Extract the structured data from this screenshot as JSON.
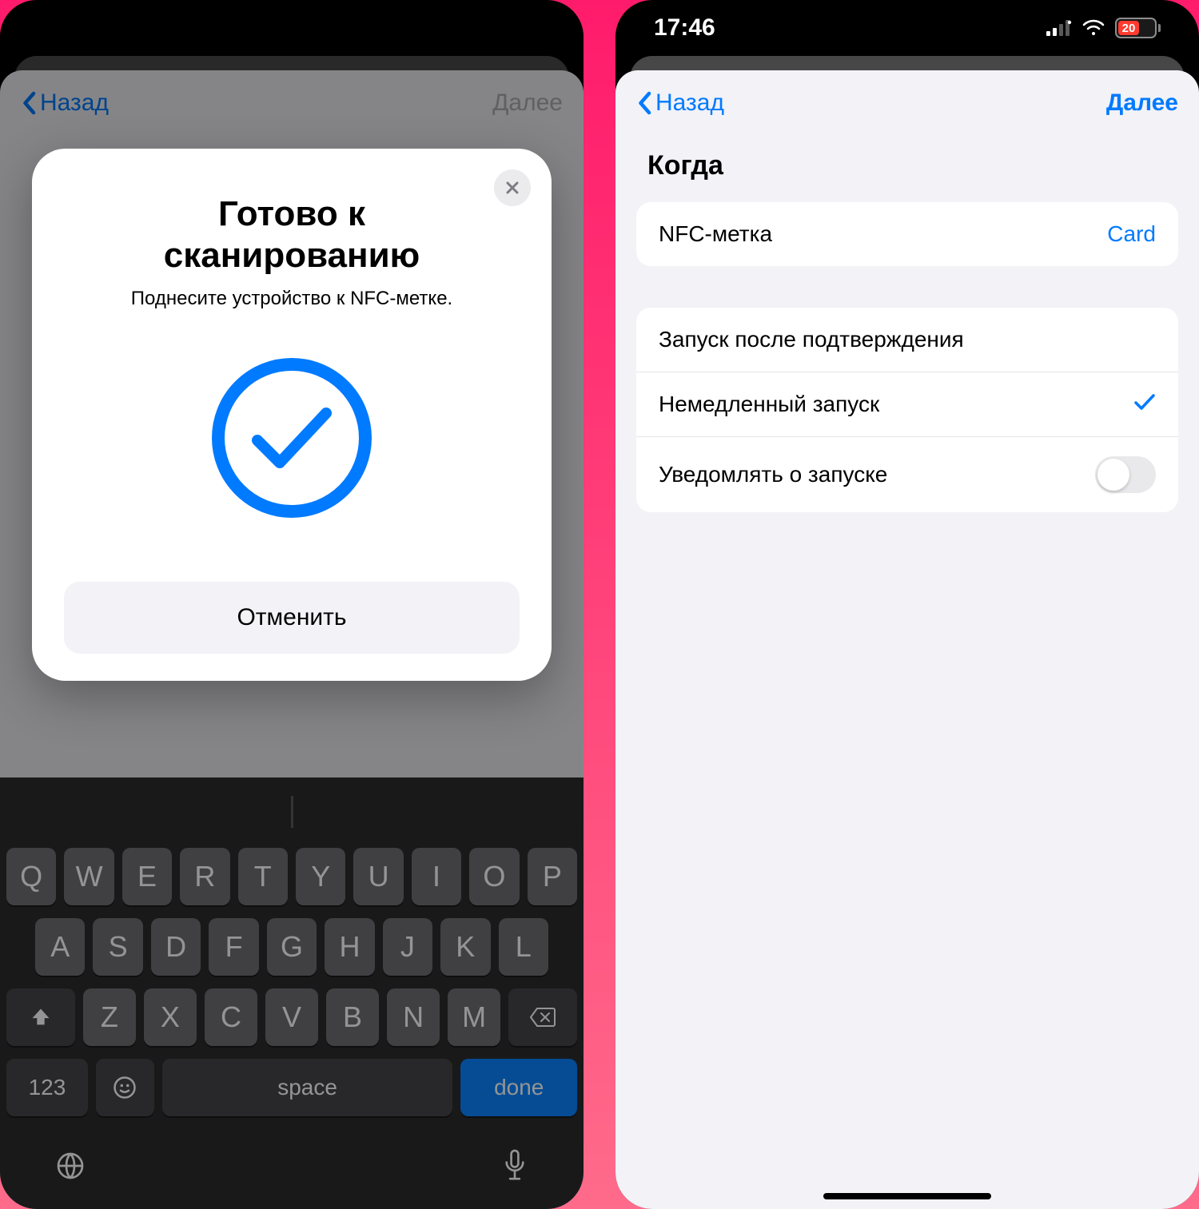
{
  "status": {
    "time": "17:46",
    "battery_pct": "20"
  },
  "nav": {
    "back": "Назад",
    "next": "Далее"
  },
  "modal": {
    "title_line1": "Готово к",
    "title_line2": "сканированию",
    "subtitle": "Поднесите устройство к NFC-метке.",
    "cancel": "Отменить"
  },
  "keyboard": {
    "row1": [
      "Q",
      "W",
      "E",
      "R",
      "T",
      "Y",
      "U",
      "I",
      "O",
      "P"
    ],
    "row2": [
      "A",
      "S",
      "D",
      "F",
      "G",
      "H",
      "J",
      "K",
      "L"
    ],
    "row3": [
      "Z",
      "X",
      "C",
      "V",
      "B",
      "N",
      "M"
    ],
    "numKey": "123",
    "space": "space",
    "done": "done"
  },
  "right": {
    "section_title": "Когда",
    "nfc_label": "NFC-метка",
    "nfc_value": "Card",
    "opt_confirm": "Запуск после подтверждения",
    "opt_immediate": "Немедленный запуск",
    "opt_notify": "Уведомлять о запуске"
  }
}
